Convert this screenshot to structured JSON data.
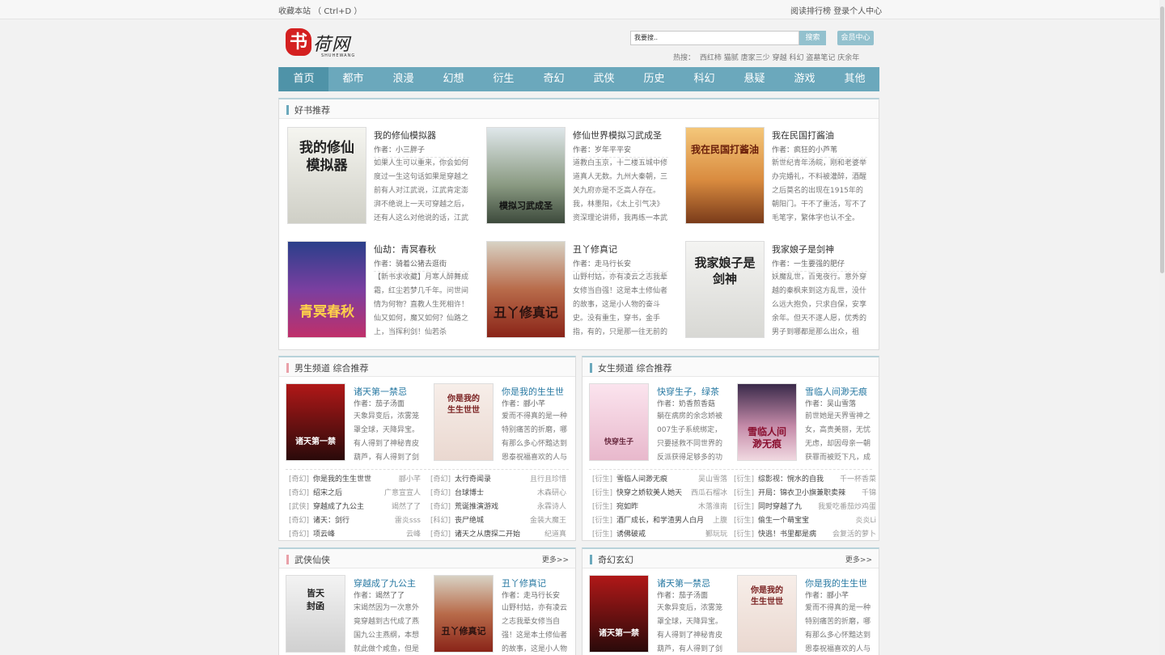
{
  "topbar": {
    "bookmark": "收藏本站 （ Ctrl+D ）",
    "links": [
      "阅读排行榜",
      "登录个人中心"
    ]
  },
  "logo": {
    "seal": "书",
    "text": "荷网",
    "pinyin": "SHUHEWANG"
  },
  "search": {
    "placeholder": "我要搜..",
    "button": "搜索",
    "vip": "会员中心"
  },
  "hot": {
    "label": "热搜：",
    "items": [
      "西红柿",
      "猫腻",
      "唐家三少",
      "穿越",
      "科幻",
      "盗墓笔记",
      "庆余年"
    ]
  },
  "nav": [
    "首页",
    "都市",
    "浪漫",
    "幻想",
    "衍生",
    "奇幻",
    "武侠",
    "历史",
    "科幻",
    "悬疑",
    "游戏",
    "其他"
  ],
  "featured": {
    "title": "好书推荐",
    "books": [
      {
        "title": "我的修仙模拟器",
        "author": "作者：小三胖子",
        "desc": "如果人生可以重来，你会如何度过一生这句话如果是穿越之前有人对江武说，江武肯定澎湃不绝说上一天可穿越之后，还有人这么对他说的话，江武",
        "cover_text": "我的修仙模拟器"
      },
      {
        "title": "修仙世界模拟习武成圣",
        "author": "作者：岁年平平安",
        "desc": "道教白玉京，十二楼五城中修道真人无数。九州大秦朝，三关九府亦是不乏高人存在。我，林墨阳，《太上引气决》资深理论讲师，我再练一本武",
        "cover_text": "模拟习武成圣"
      },
      {
        "title": "我在民国打酱油",
        "author": "作者：疯狂的小芦苇",
        "desc": "新世纪青年汤皖，刚和老婆举办完婚礼，不料被灌醉，酒醒之后莫名的出现在1915年的朝阳门。干不了重活，写不了毛笔字，繁体字也认不全。",
        "cover_text": "我在民国打酱油"
      },
      {
        "title": "仙劫：青冥春秋",
        "author": "作者：骑着公猪去逛街",
        "desc": "【新书求收藏】月寒人醉舞成霜，红尘若梦几千年。问世间情为何物？直教人生死相许！仙又如何，魔又如何？仙路之上，当挥利剑！仙若杀",
        "cover_text": "青冥春秋"
      },
      {
        "title": "丑丫修真记",
        "author": "作者：走马行长安",
        "desc": "山野村姑，亦有凌云之志我辈女修当自强！这是本土修仙者的故事，这是小人物的奋斗史。没有重生，穿书，金手指，有的，只是那一往无前的",
        "cover_text": "丑丫修真记"
      },
      {
        "title": "我家娘子是剑神",
        "author": "作者：一生要强的肥仔",
        "desc": "妖魔乱世，百鬼夜行。意外穿越的秦枫来到这方乱世，没什么远大抱负，只求自保，安享余年。但天不遂人愿，优秀的男子到哪都是那么出众，祖",
        "cover_text": "我家娘子是剑神"
      }
    ]
  },
  "male": {
    "title": "男生频道 综合推荐",
    "books": [
      {
        "title": "诸天第一禁忌",
        "author": "作者：茄子汤面",
        "desc": "天象异变后，浓雾笼罩全球，天降异宝。有人得到了神秘青皮葫芦，有人得到了剑",
        "cover_text": "诸天第一禁"
      },
      {
        "title": "你是我的生生世",
        "author": "作者：郦小芊",
        "desc": "爱而不得真的是一种特别痛苦的折磨，哪有那么多心怀黯达到恩泰祝福喜欢的人与",
        "cover_text": "你是我的生生世世"
      }
    ],
    "list": [
      [
        "[奇幻]",
        "你是我的生生世世",
        "郦小芊",
        "[奇幻]",
        "太行奇闻录",
        "且行且珍惜"
      ],
      [
        "[奇幻]",
        "绍宋之后",
        "广意宣宣人",
        "[奇幻]",
        "台球博士",
        "木森研心"
      ],
      [
        "[武侠]",
        "穿越成了九公主",
        "竭然了了",
        "[奇幻]",
        "荒诞推演游戏",
        "永霖诗人"
      ],
      [
        "[奇幻]",
        "诸天：剑行",
        "雷炎sss",
        "[科幻]",
        "丧尸绝城",
        "金装大魔王"
      ],
      [
        "[奇幻]",
        "项云峰",
        "云峰",
        "[奇幻]",
        "诸天之从唐探二开始",
        "纪道真"
      ]
    ]
  },
  "female": {
    "title": "女生频道 综合推荐",
    "books": [
      {
        "title": "快穿生子，绿茶",
        "author": "作者：奶香煎香菇",
        "desc": "躺在病房的余念娇被007生子系统绑定，只要拯救不同世界的反派获得足够多的功",
        "cover_text": "快穿生子"
      },
      {
        "title": "雪临人间渺无痕",
        "author": "作者：吴山雪落",
        "desc": "前世她是天界雪神之女，高贵美丽，无忧无虑，却因母亲一朝获罪而被贬下凡，成",
        "cover_text": "雪临人间渺无痕"
      }
    ],
    "list": [
      [
        "[衍生]",
        "雪临人间渺无痕",
        "吴山雪落",
        "[衍生]",
        "综影视：惋水的自我",
        "千一杯香菜"
      ],
      [
        "[衍生]",
        "快穿之娇软美人她天",
        "西瓜石榴冰",
        "[衍生]",
        "开局：锦衣卫小旗兼职卖辣",
        "千锦"
      ],
      [
        "[衍生]",
        "宛如昨",
        "木落淮南",
        "[衍生]",
        "同时穿越了九",
        "我爱吃番茄炒鸡蛋"
      ],
      [
        "[衍生]",
        "酒厂成长，和学渣男人白月",
        "上腹",
        "[衍生]",
        "偷生一个萌宝宝",
        "炎炎Li"
      ],
      [
        "[衍生]",
        "诱佛破戒",
        "鄞玩玩",
        "[衍生]",
        "快逃！书里都是病",
        "会复活的萝卜"
      ]
    ]
  },
  "wuxia": {
    "title": "武侠仙侠",
    "more": "更多>>",
    "books": [
      {
        "title": "穿越成了九公主",
        "author": "作者：竭然了了",
        "desc": "宋竭然因为一次意外竟穿越到古代成了燕国九公主燕纲，本想就此做个咸鱼，但是",
        "cover_text": "皆天封函"
      },
      {
        "title": "丑丫修真记",
        "author": "作者：走马行长安",
        "desc": "山野村姑，亦有凌云之志我辈女修当自强！这是本土修仙者的故事，这是小人物",
        "cover_text": "丑丫修真记"
      }
    ]
  },
  "qihuan": {
    "title": "奇幻玄幻",
    "more": "更多>>",
    "books": [
      {
        "title": "诸天第一禁忌",
        "author": "作者：茄子汤面",
        "desc": "天象异变后，浓雾笼罩全球，天降异宝。有人得到了神秘青皮葫芦，有人得到了剑",
        "cover_text": "诸天第一禁"
      },
      {
        "title": "你是我的生生世",
        "author": "作者：郦小芊",
        "desc": "爱而不得真的是一种特别痛苦的折磨，哪有那么多心怀黯达到恩泰祝福喜欢的人与",
        "cover_text": "你是我的生生世世"
      }
    ]
  }
}
